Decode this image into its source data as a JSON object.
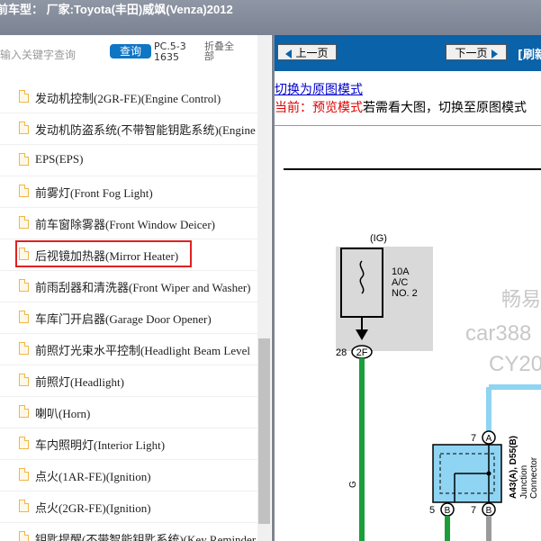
{
  "titlebar": {
    "text": "前车型：  厂家:Toyota(丰田)威飒(Venza)2012"
  },
  "left": {
    "search_placeholder": "输入关键字查询",
    "query_button": "查询",
    "pc_label": "PC.5-31635",
    "collapse_label": "折叠全部"
  },
  "tree_items": [
    {
      "label": "发动机控制(2GR-FE)(Engine Control)"
    },
    {
      "label": "发动机防盗系统(不带智能钥匙系统)(Engine"
    },
    {
      "label": "EPS(EPS)"
    },
    {
      "label": "前雾灯(Front Fog Light)"
    },
    {
      "label": "前车窗除雾器(Front Window Deicer)"
    },
    {
      "label": "后视镜加热器(Mirror Heater)"
    },
    {
      "label": "前雨刮器和清洗器(Front Wiper and Washer)"
    },
    {
      "label": "车库门开启器(Garage Door Opener)"
    },
    {
      "label": "前照灯光束水平控制(Headlight Beam Level"
    },
    {
      "label": "前照灯(Headlight)"
    },
    {
      "label": "喇叭(Horn)"
    },
    {
      "label": "车内照明灯(Interior Light)"
    },
    {
      "label": "点火(1AR-FE)(Ignition)"
    },
    {
      "label": "点火(2GR-FE)(Ignition)"
    },
    {
      "label": "钥匙提醒(不带智能钥匙系统)(Key Reminder"
    }
  ],
  "selected_index": 5,
  "right": {
    "prev_button": "上一页",
    "next_button": "下一页",
    "refresh_label": "[刷新",
    "mode_link": "切换为原图模式",
    "notice_prefix": "当前：预览模式",
    "notice_rest": "若需看大图，切换至原图模式"
  },
  "diagram": {
    "ig_label": "(IG)",
    "fuse_label_1": "10A",
    "fuse_label_2": "A/C",
    "fuse_label_3": "NO. 2",
    "pin_28": "28",
    "pin_2f": "2F",
    "wire_g": "G",
    "pin_7": "7",
    "pin_a": "A",
    "conn_label": "A43(A), D55(B)",
    "jc_label_1": "Junction",
    "jc_label_2": "Connector",
    "pin_5": "5",
    "pin_b1": "B",
    "pin_7b": "7",
    "pin_b2": "B",
    "watermark_1": "畅易",
    "watermark_2": "car388",
    "watermark_3": "CY20"
  }
}
